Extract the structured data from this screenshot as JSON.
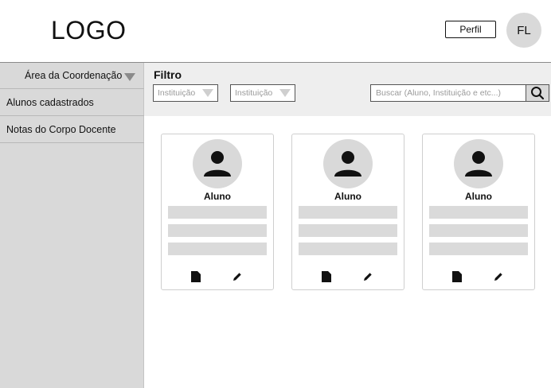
{
  "header": {
    "logo": "LOGO",
    "profile_button": "Perfil",
    "avatar_initials": "FL"
  },
  "sidebar": {
    "section_label": "Área da Coordenação",
    "items": [
      {
        "label": "Alunos cadastrados"
      },
      {
        "label": "Notas do Corpo Docente"
      }
    ]
  },
  "filter": {
    "title": "Filtro",
    "selects": [
      {
        "value": "Instituição"
      },
      {
        "value": "Instituição"
      }
    ],
    "search_placeholder": "Buscar (Aluno, Instituição e etc...)"
  },
  "cards": [
    {
      "name": "Aluno"
    },
    {
      "name": "Aluno"
    },
    {
      "name": "Aluno"
    }
  ],
  "icons": {
    "search": "search-icon",
    "user": "user-icon",
    "document": "document-icon",
    "edit": "pencil-icon"
  },
  "colors": {
    "sidebar_bg": "#d9d9d9",
    "filter_bg": "#eeeeee",
    "placeholder_bar": "#dadada",
    "text": "#111111"
  }
}
